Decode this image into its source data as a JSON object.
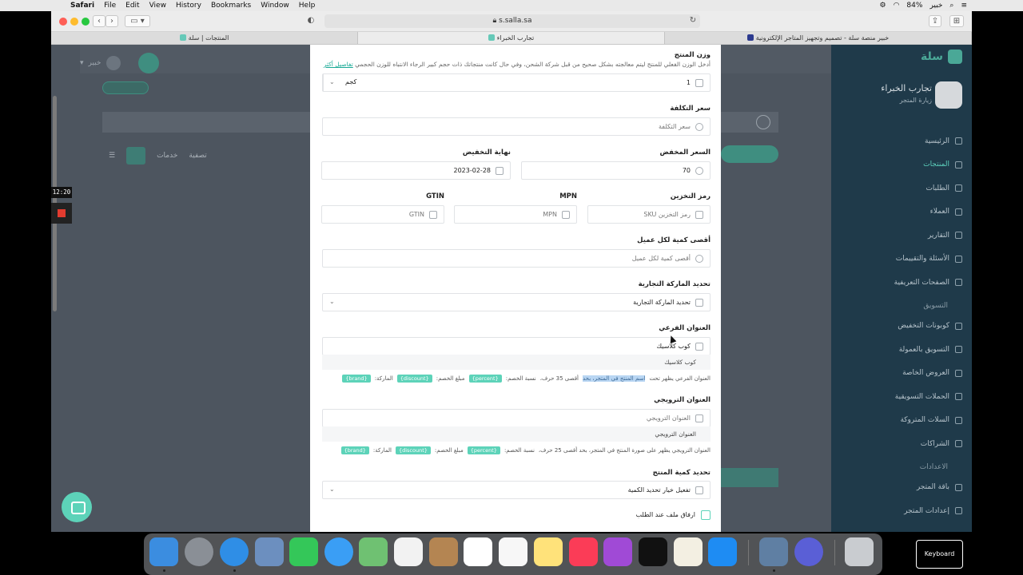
{
  "menubar": {
    "app": "Safari",
    "items": [
      "File",
      "Edit",
      "View",
      "History",
      "Bookmarks",
      "Window",
      "Help"
    ],
    "battery": "84%",
    "user": "خبير"
  },
  "browser": {
    "address": "s.salla.sa",
    "tabs": [
      {
        "label": "المنتجات | سلة"
      },
      {
        "label": "تجارب الخبراء"
      },
      {
        "label": "خبير منصة سلة - تصميم وتجهيز المتاجر الإلكترونية"
      }
    ]
  },
  "background": {
    "user_name": "خبير",
    "logo": "سلة",
    "store_name": "تجارب الخبراء",
    "store_link": "زيارة المتجر",
    "filter_label": "تصفية",
    "services_label": "خدمات",
    "sidebar": [
      {
        "label": "الرئيسية",
        "active": false
      },
      {
        "label": "المنتجات",
        "active": true
      },
      {
        "label": "الطلبات",
        "active": false
      },
      {
        "label": "العملاء",
        "active": false
      },
      {
        "label": "التقارير",
        "active": false
      },
      {
        "label": "الأسئلة والتقييمات",
        "active": false
      },
      {
        "label": "الصفحات التعريفية",
        "active": false
      }
    ],
    "sidebar_section_marketing": "التسويق",
    "sidebar_marketing": [
      {
        "label": "كوبونات التخفيض"
      },
      {
        "label": "التسويق بالعمولة"
      },
      {
        "label": "العروض الخاصة"
      },
      {
        "label": "الحملات التسويقية"
      },
      {
        "label": "السلات المتروكة"
      },
      {
        "label": "الشراكات"
      }
    ],
    "sidebar_section_settings": "الاعدادات",
    "sidebar_settings": [
      {
        "label": "باقة المتجر"
      },
      {
        "label": "إعدادات المتجر"
      }
    ]
  },
  "form": {
    "weight": {
      "label": "وزن المنتج",
      "help": "أدخل الوزن الفعلي للمنتج ليتم معالجته بشكل صحيح من قبل شركة الشحن، وفي حال كانت منتجاتك ذات حجم كبير الرجاء الانتباه للوزن الحجمي",
      "help_link": "تفاصيل أكثر",
      "value": "1",
      "unit": "كجم"
    },
    "cost": {
      "label": "سعر التكلفة",
      "placeholder": "سعر التكلفة"
    },
    "sale_price": {
      "label": "السعر المخفض",
      "value": "70"
    },
    "sale_end": {
      "label": "نهاية التخفيض",
      "value": "2023-02-28"
    },
    "sku": {
      "label": "رمز التخزين",
      "placeholder": "رمز التخزين SKU"
    },
    "mpn": {
      "label": "MPN",
      "placeholder": "MPN"
    },
    "gtin": {
      "label": "GTIN",
      "placeholder": "GTIN"
    },
    "max_qty": {
      "label": "أقصى كمية لكل عميل",
      "placeholder": "أقصى كمية لكل عميل"
    },
    "brand": {
      "label": "تحديد الماركة التجارية",
      "value": "تحديد الماركة التجارية"
    },
    "subtitle": {
      "label": "العنوان الفرعي",
      "value": "كوب كلاسيك",
      "preview": "كوب كلاسيك",
      "help_a": "العنوان الفرعي يظهر تحت",
      "help_hl": "اسم المنتج في المتجر، بحد",
      "help_b": "أقصى 35 حرف،",
      "pct_label": "نسبة الخصم:",
      "pct_tag": "{percent}",
      "disc_label": "مبلغ الخصم:",
      "disc_tag": "{discount}",
      "brand_label": "الماركة:",
      "brand_tag": "{brand}"
    },
    "promo": {
      "label": "العنوان الترويجي",
      "placeholder": "العنوان الترويجي",
      "preview": "العنوان الترويجي",
      "help": "العنوان الترويجي يظهر على صورة المنتج في المتجر، بحد أقصى 25 حرف،",
      "pct_label": "نسبة الخصم:",
      "pct_tag": "{percent}",
      "disc_label": "مبلغ الخصم:",
      "disc_tag": "{discount}",
      "brand_label": "الماركة:",
      "brand_tag": "{brand}"
    },
    "qty_limit": {
      "label": "تحديد كمية المنتج",
      "value": "تفعيل خيار تحديد الكمية"
    },
    "attach_file": {
      "label": "ارفاق ملف عند الطلب"
    }
  },
  "recording": {
    "time": "12:20"
  },
  "dock": {
    "keyboard_label": "Keyboard"
  }
}
